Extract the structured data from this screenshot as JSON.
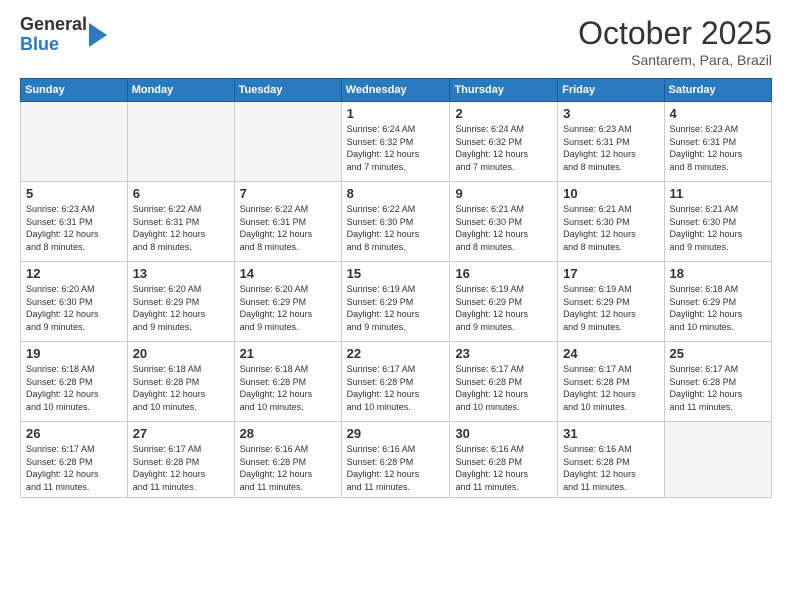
{
  "header": {
    "logo": {
      "line1": "General",
      "line2": "Blue"
    },
    "title": "October 2025",
    "subtitle": "Santarem, Para, Brazil"
  },
  "weekdays": [
    "Sunday",
    "Monday",
    "Tuesday",
    "Wednesday",
    "Thursday",
    "Friday",
    "Saturday"
  ],
  "weeks": [
    [
      {
        "day": "",
        "info": ""
      },
      {
        "day": "",
        "info": ""
      },
      {
        "day": "",
        "info": ""
      },
      {
        "day": "1",
        "info": "Sunrise: 6:24 AM\nSunset: 6:32 PM\nDaylight: 12 hours\nand 7 minutes."
      },
      {
        "day": "2",
        "info": "Sunrise: 6:24 AM\nSunset: 6:32 PM\nDaylight: 12 hours\nand 7 minutes."
      },
      {
        "day": "3",
        "info": "Sunrise: 6:23 AM\nSunset: 6:31 PM\nDaylight: 12 hours\nand 8 minutes."
      },
      {
        "day": "4",
        "info": "Sunrise: 6:23 AM\nSunset: 6:31 PM\nDaylight: 12 hours\nand 8 minutes."
      }
    ],
    [
      {
        "day": "5",
        "info": "Sunrise: 6:23 AM\nSunset: 6:31 PM\nDaylight: 12 hours\nand 8 minutes."
      },
      {
        "day": "6",
        "info": "Sunrise: 6:22 AM\nSunset: 6:31 PM\nDaylight: 12 hours\nand 8 minutes."
      },
      {
        "day": "7",
        "info": "Sunrise: 6:22 AM\nSunset: 6:31 PM\nDaylight: 12 hours\nand 8 minutes."
      },
      {
        "day": "8",
        "info": "Sunrise: 6:22 AM\nSunset: 6:30 PM\nDaylight: 12 hours\nand 8 minutes."
      },
      {
        "day": "9",
        "info": "Sunrise: 6:21 AM\nSunset: 6:30 PM\nDaylight: 12 hours\nand 8 minutes."
      },
      {
        "day": "10",
        "info": "Sunrise: 6:21 AM\nSunset: 6:30 PM\nDaylight: 12 hours\nand 8 minutes."
      },
      {
        "day": "11",
        "info": "Sunrise: 6:21 AM\nSunset: 6:30 PM\nDaylight: 12 hours\nand 9 minutes."
      }
    ],
    [
      {
        "day": "12",
        "info": "Sunrise: 6:20 AM\nSunset: 6:30 PM\nDaylight: 12 hours\nand 9 minutes."
      },
      {
        "day": "13",
        "info": "Sunrise: 6:20 AM\nSunset: 6:29 PM\nDaylight: 12 hours\nand 9 minutes."
      },
      {
        "day": "14",
        "info": "Sunrise: 6:20 AM\nSunset: 6:29 PM\nDaylight: 12 hours\nand 9 minutes."
      },
      {
        "day": "15",
        "info": "Sunrise: 6:19 AM\nSunset: 6:29 PM\nDaylight: 12 hours\nand 9 minutes."
      },
      {
        "day": "16",
        "info": "Sunrise: 6:19 AM\nSunset: 6:29 PM\nDaylight: 12 hours\nand 9 minutes."
      },
      {
        "day": "17",
        "info": "Sunrise: 6:19 AM\nSunset: 6:29 PM\nDaylight: 12 hours\nand 9 minutes."
      },
      {
        "day": "18",
        "info": "Sunrise: 6:18 AM\nSunset: 6:29 PM\nDaylight: 12 hours\nand 10 minutes."
      }
    ],
    [
      {
        "day": "19",
        "info": "Sunrise: 6:18 AM\nSunset: 6:28 PM\nDaylight: 12 hours\nand 10 minutes."
      },
      {
        "day": "20",
        "info": "Sunrise: 6:18 AM\nSunset: 6:28 PM\nDaylight: 12 hours\nand 10 minutes."
      },
      {
        "day": "21",
        "info": "Sunrise: 6:18 AM\nSunset: 6:28 PM\nDaylight: 12 hours\nand 10 minutes."
      },
      {
        "day": "22",
        "info": "Sunrise: 6:17 AM\nSunset: 6:28 PM\nDaylight: 12 hours\nand 10 minutes."
      },
      {
        "day": "23",
        "info": "Sunrise: 6:17 AM\nSunset: 6:28 PM\nDaylight: 12 hours\nand 10 minutes."
      },
      {
        "day": "24",
        "info": "Sunrise: 6:17 AM\nSunset: 6:28 PM\nDaylight: 12 hours\nand 10 minutes."
      },
      {
        "day": "25",
        "info": "Sunrise: 6:17 AM\nSunset: 6:28 PM\nDaylight: 12 hours\nand 11 minutes."
      }
    ],
    [
      {
        "day": "26",
        "info": "Sunrise: 6:17 AM\nSunset: 6:28 PM\nDaylight: 12 hours\nand 11 minutes."
      },
      {
        "day": "27",
        "info": "Sunrise: 6:17 AM\nSunset: 6:28 PM\nDaylight: 12 hours\nand 11 minutes."
      },
      {
        "day": "28",
        "info": "Sunrise: 6:16 AM\nSunset: 6:28 PM\nDaylight: 12 hours\nand 11 minutes."
      },
      {
        "day": "29",
        "info": "Sunrise: 6:16 AM\nSunset: 6:28 PM\nDaylight: 12 hours\nand 11 minutes."
      },
      {
        "day": "30",
        "info": "Sunrise: 6:16 AM\nSunset: 6:28 PM\nDaylight: 12 hours\nand 11 minutes."
      },
      {
        "day": "31",
        "info": "Sunrise: 6:16 AM\nSunset: 6:28 PM\nDaylight: 12 hours\nand 11 minutes."
      },
      {
        "day": "",
        "info": ""
      }
    ]
  ]
}
